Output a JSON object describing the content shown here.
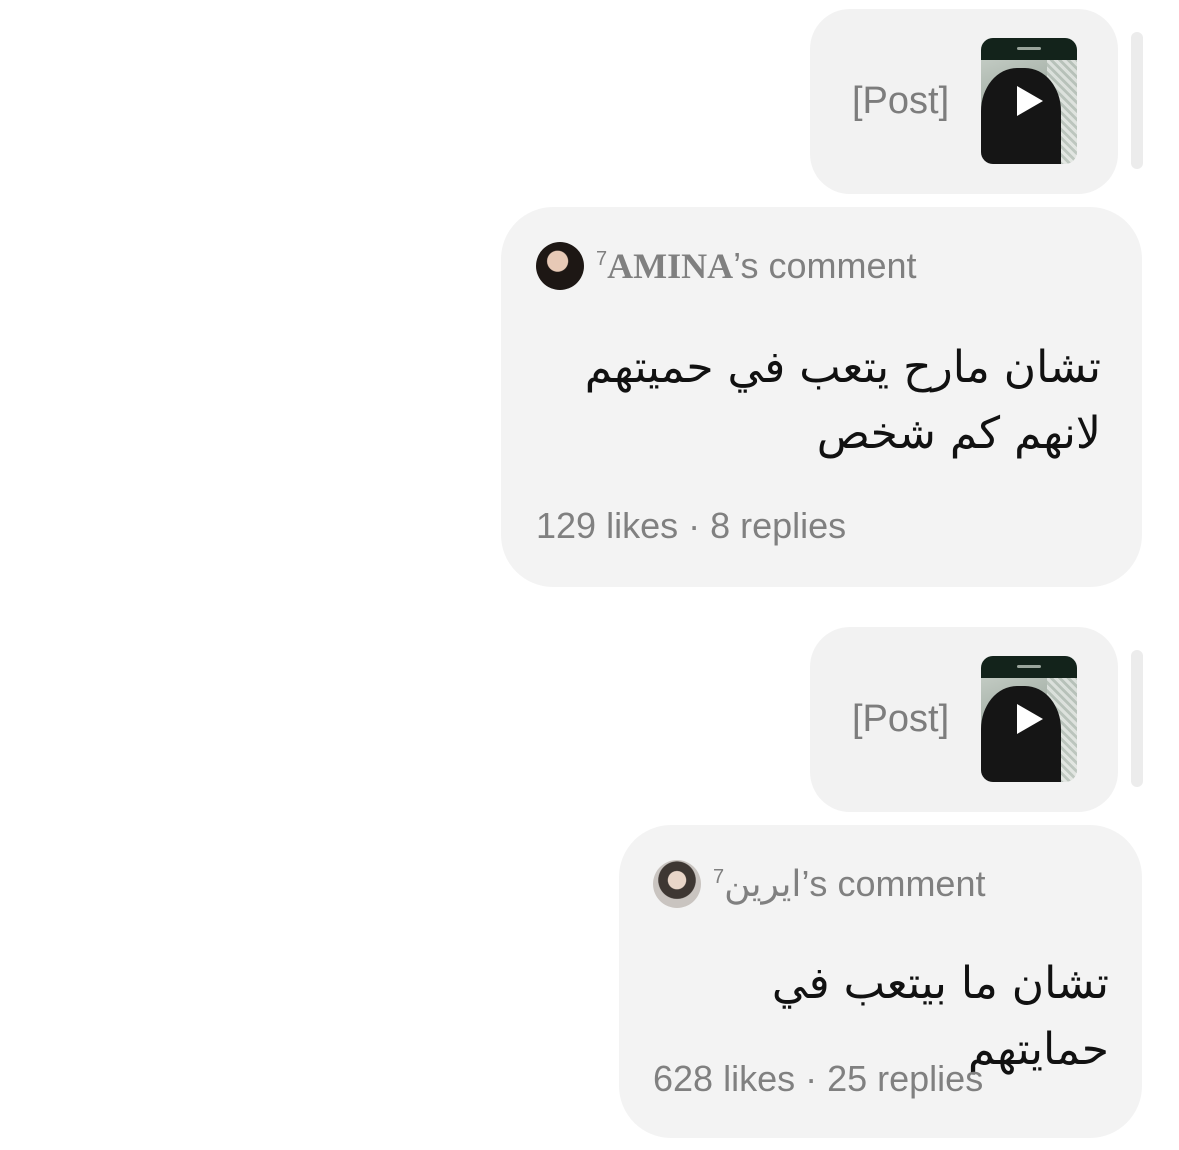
{
  "thread": [
    {
      "type": "post",
      "label": "[Post]"
    },
    {
      "type": "comment",
      "superscript": "7",
      "username": "AMINA",
      "suffix": "’s comment",
      "body": "تشان مارح يتعب في حميتهم لانهم كم شخص",
      "likes": "129 likes",
      "replies": "8 replies"
    },
    {
      "type": "post",
      "label": "[Post]"
    },
    {
      "type": "comment",
      "username": "ايرين",
      "superscript": "7",
      "suffix": "’s comment",
      "body": "تشان ما بيتعب في حمايتهم",
      "likes": "628 likes",
      "replies": "25 replies"
    }
  ],
  "separator": " · ",
  "icons": {
    "play": "play-icon",
    "avatar": "avatar"
  },
  "colors": {
    "bubble": "#f2f2f2",
    "muted_text": "#808080",
    "body_text": "#111111"
  }
}
